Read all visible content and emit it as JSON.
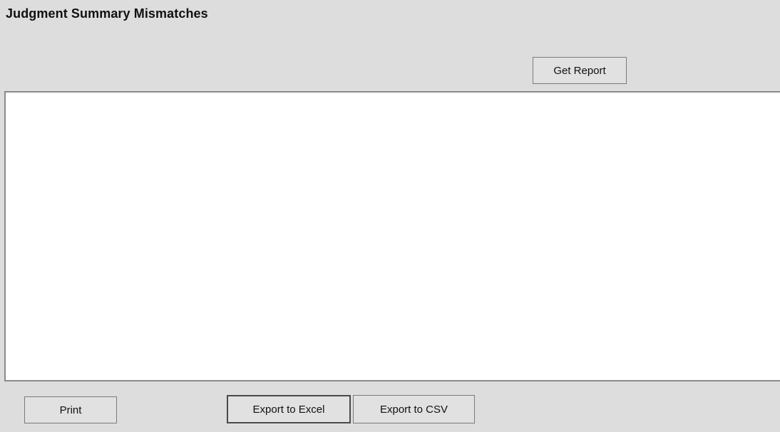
{
  "window": {
    "title": "Judgment Summary Mismatches"
  },
  "toolbar": {
    "get_report_label": "Get Report"
  },
  "footer": {
    "print_label": "Print",
    "export_excel_label": "Export to Excel",
    "export_csv_label": "Export to CSV"
  }
}
